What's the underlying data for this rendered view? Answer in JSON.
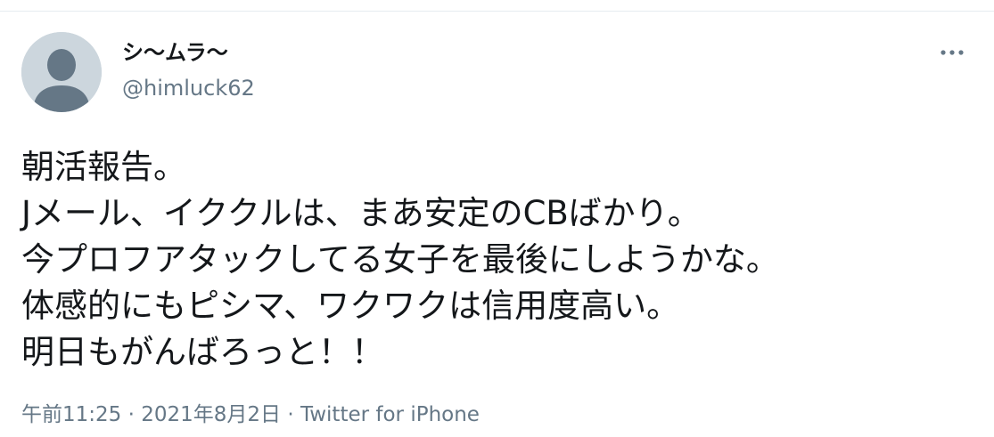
{
  "author": {
    "display_name": "シ〜ムラ〜",
    "handle": "@himluck62",
    "avatar_icon": "default-profile-icon"
  },
  "actions": {
    "more_icon": "more-horizontal-icon"
  },
  "tweet": {
    "lines": [
      "朝活報告。",
      "Jメール、イククルは、まあ安定のCBばかり。",
      "今プロフアタックしてる女子を最後にしようかな。",
      "体感的にもピシマ、ワクワクは信用度高い。",
      "明日もがんばろっと！！"
    ]
  },
  "meta": {
    "time": "午前11:25",
    "separator": " · ",
    "date": "2021年8月2日",
    "source": "Twitter for iPhone"
  },
  "colors": {
    "text_primary": "#14171a",
    "text_secondary": "#657786",
    "avatar_bg": "#ccd6dd",
    "avatar_silhouette": "#657786",
    "border": "#e6ecf0"
  }
}
